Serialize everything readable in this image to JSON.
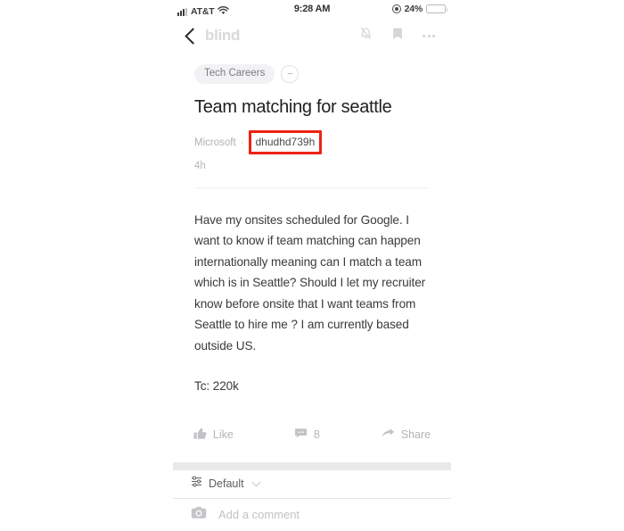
{
  "status_bar": {
    "carrier": "AT&T",
    "time": "9:28 AM",
    "battery_percent": "24%",
    "signal_icon": "signal-bars-icon",
    "wifi_icon": "wifi-icon",
    "low_power_icon": "low-power-mode-icon",
    "battery_color": "#f5c518",
    "battery_level": 24
  },
  "nav": {
    "back_icon": "chevron-left-icon",
    "brand": "blind",
    "notifications_icon": "bell-muted-icon",
    "bookmark_icon": "bookmark-icon",
    "overflow_icon": "more-dots-icon"
  },
  "post": {
    "tag": "Tech Careers",
    "tag_more_label": "–",
    "title": "Team matching for seattle",
    "company": "Microsoft",
    "meta_separator": "·",
    "username": "dhudhd739h",
    "time_ago": "4h",
    "highlight_color": "#ee2211",
    "body": "Have my onsites scheduled for Google. I want to know if team matching can happen internationally meaning can I match a team which is in Seattle? Should I let my recruiter know before onsite that I want teams from Seattle to hire me ? I am currently based outside US.",
    "tc": "Tc: 220k"
  },
  "actions": {
    "like_label": "Like",
    "like_icon": "thumbs-up-icon",
    "comment_count": "8",
    "comment_icon": "comment-bubble-icon",
    "share_label": "Share",
    "share_icon": "share-arrow-icon"
  },
  "comments_section": {
    "sort_icon": "sliders-icon",
    "sort_label": "Default",
    "sort_chevron_icon": "chevron-down-icon",
    "camera_icon": "camera-icon",
    "comment_placeholder": "Add a comment"
  }
}
